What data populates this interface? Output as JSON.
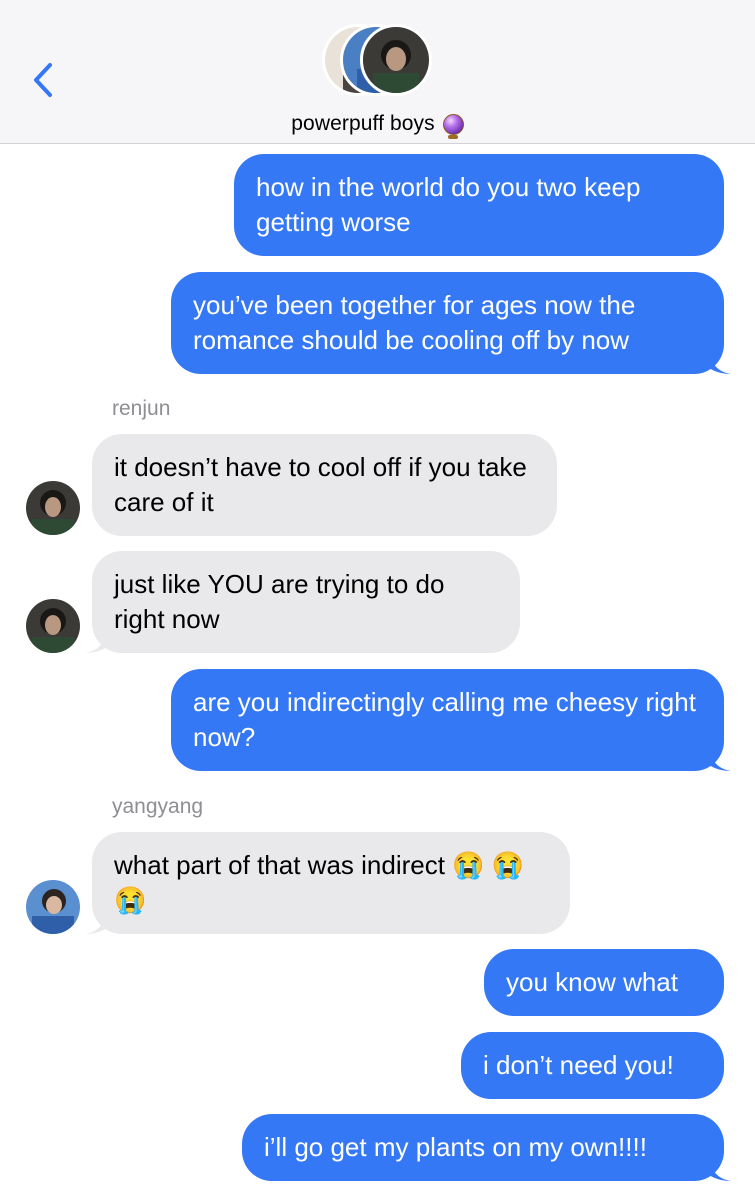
{
  "conversation": {
    "title": "powerpuff boys",
    "title_icon": "crystal-ball-icon"
  },
  "colors": {
    "sent_bubble": "#3478f6",
    "received_bubble": "#e9e9eb",
    "header_bg": "#f6f6f8",
    "back_chevron": "#3478f6",
    "sender_label": "#8e8e93"
  },
  "messages": [
    {
      "direction": "sent",
      "text": "how in the world do you two keep getting worse"
    },
    {
      "direction": "sent",
      "text": "you’ve been together for ages now the romance should be cooling off by now"
    },
    {
      "direction": "received",
      "sender": "renjun",
      "text": "it doesn’t have to cool off if you take care of it"
    },
    {
      "direction": "received",
      "text": "just like YOU are trying to do right now"
    },
    {
      "direction": "sent",
      "text": "are you indirectingly calling me cheesy right now?"
    },
    {
      "direction": "received",
      "sender": "yangyang",
      "text": "what part of that was indirect 😭 😭 😭"
    },
    {
      "direction": "sent",
      "text": "you know what"
    },
    {
      "direction": "sent",
      "text": "i don’t need you!"
    },
    {
      "direction": "sent",
      "text": "i’ll go get my plants on my own!!!!"
    }
  ]
}
